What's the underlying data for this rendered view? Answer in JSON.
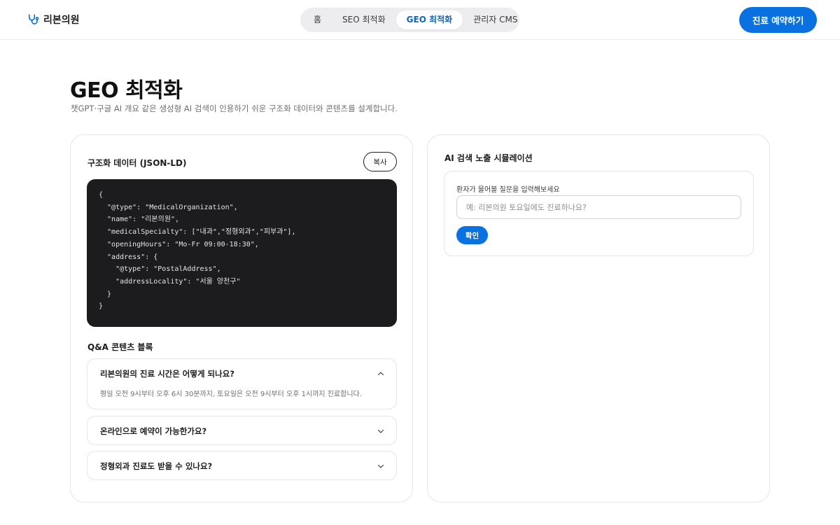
{
  "brand": {
    "name": "리본의원",
    "icon": "stethoscope-icon",
    "icon_color": "#0a72e0"
  },
  "nav": {
    "tabs": [
      {
        "label": "홈",
        "active": false
      },
      {
        "label": "SEO 최적화",
        "active": false
      },
      {
        "label": "GEO 최적화",
        "active": true
      },
      {
        "label": "관리자 CMS",
        "active": false
      }
    ]
  },
  "header": {
    "cta_label": "진료 예약하기"
  },
  "page": {
    "title": "GEO 최적화",
    "subtitle": "챗GPT·구글 AI 개요 같은 생성형 AI 검색이 인용하기 쉬운 구조화 데이터와 콘텐츠를 설계합니다."
  },
  "structured_data": {
    "heading": "구조화 데이터 (JSON-LD)",
    "copy_label": "복사",
    "code": "{\n  \"@type\": \"MedicalOrganization\",\n  \"name\": \"리본의원\",\n  \"medicalSpecialty\": [\"내과\",\"정형외과\",\"피부과\"],\n  \"openingHours\": \"Mo-Fr 09:00-18:30\",\n  \"address\": {\n    \"@type\": \"PostalAddress\",\n    \"addressLocality\": \"서울 양천구\"\n  }\n}"
  },
  "qa": {
    "heading": "Q&A 콘텐츠 블록",
    "items": [
      {
        "question": "리본의원의 진료 시간은 어떻게 되나요?",
        "answer": "평일 오전 9시부터 오후 6시 30분까지, 토요일은 오전 9시부터 오후 1시까지 진료합니다.",
        "expanded": true
      },
      {
        "question": "온라인으로 예약이 가능한가요?",
        "expanded": false
      },
      {
        "question": "정형외과 진료도 받을 수 있나요?",
        "expanded": false
      }
    ]
  },
  "simulation": {
    "heading": "AI 검색 노출 시뮬레이션",
    "input_label": "환자가 물어볼 질문을 입력해보세요",
    "input_value": "",
    "input_placeholder": "예: 리본의원 토요일에도 진료하나요?",
    "submit_label": "확인"
  },
  "colors": {
    "accent": "#0a72e0",
    "code_background": "#1c1c1e",
    "active_tab_text": "#0a66c2"
  }
}
